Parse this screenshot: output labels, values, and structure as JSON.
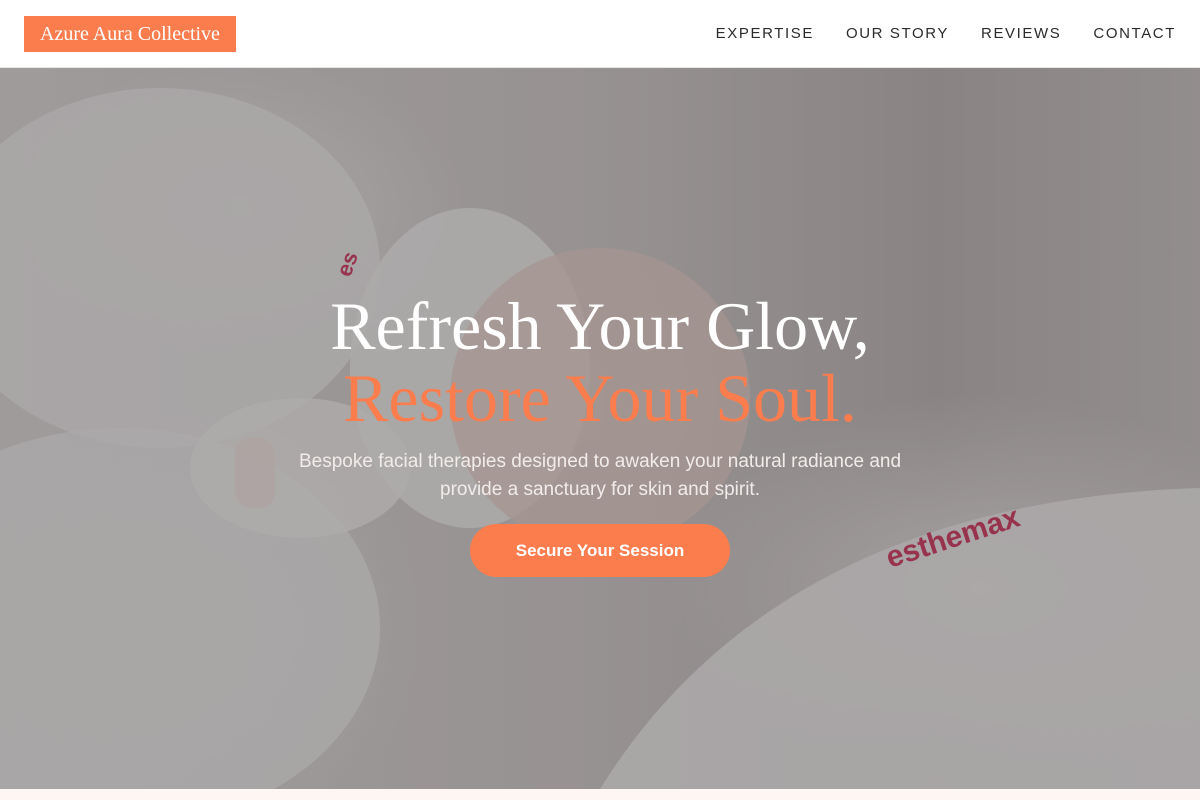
{
  "header": {
    "brand": "Azure Aura Collective",
    "nav": [
      {
        "label": "EXPERTISE"
      },
      {
        "label": "OUR STORY"
      },
      {
        "label": "REVIEWS"
      },
      {
        "label": "CONTACT"
      }
    ]
  },
  "hero": {
    "headline_line1": "Refresh Your Glow,",
    "headline_line2": "Restore Your Soul.",
    "subtext": "Bespoke facial therapies designed to awaken your natural radiance and provide a sanctuary for skin and spirit.",
    "cta_label": "Secure Your Session",
    "photo_headband_text": "es",
    "photo_robe_text": "esthemax"
  },
  "colors": {
    "accent": "#fb7d4e",
    "nav_text": "#2b2b2b",
    "headline": "#ffffff",
    "overlay": "rgba(60,55,58,0.38)"
  }
}
